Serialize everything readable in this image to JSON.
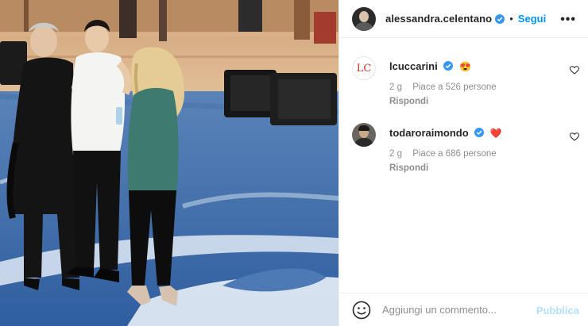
{
  "post": {
    "author": "alessandra.celentano",
    "verified": true,
    "separator": "•",
    "follow_label": "Segui",
    "more_label": "•••"
  },
  "comments": [
    {
      "avatar_text": "LC",
      "username": "lcuccarini",
      "verified": true,
      "emoji": "😍",
      "time": "2 g",
      "likes": "Piace a 526 persone",
      "reply_label": "Rispondi",
      "liked": false
    },
    {
      "username": "todaroraimondo",
      "verified": true,
      "emoji": "❤️",
      "time": "2 g",
      "likes": "Piace a 686 persone",
      "reply_label": "Rispondi",
      "liked": false
    }
  ],
  "composer": {
    "placeholder": "Aggiungi un commento...",
    "publish_label": "Pubblica"
  },
  "colors": {
    "accent": "#0095f6",
    "publish_disabled": "#b2dffc",
    "verified": "#3897f0",
    "secondary_text": "#8e8e8e"
  }
}
